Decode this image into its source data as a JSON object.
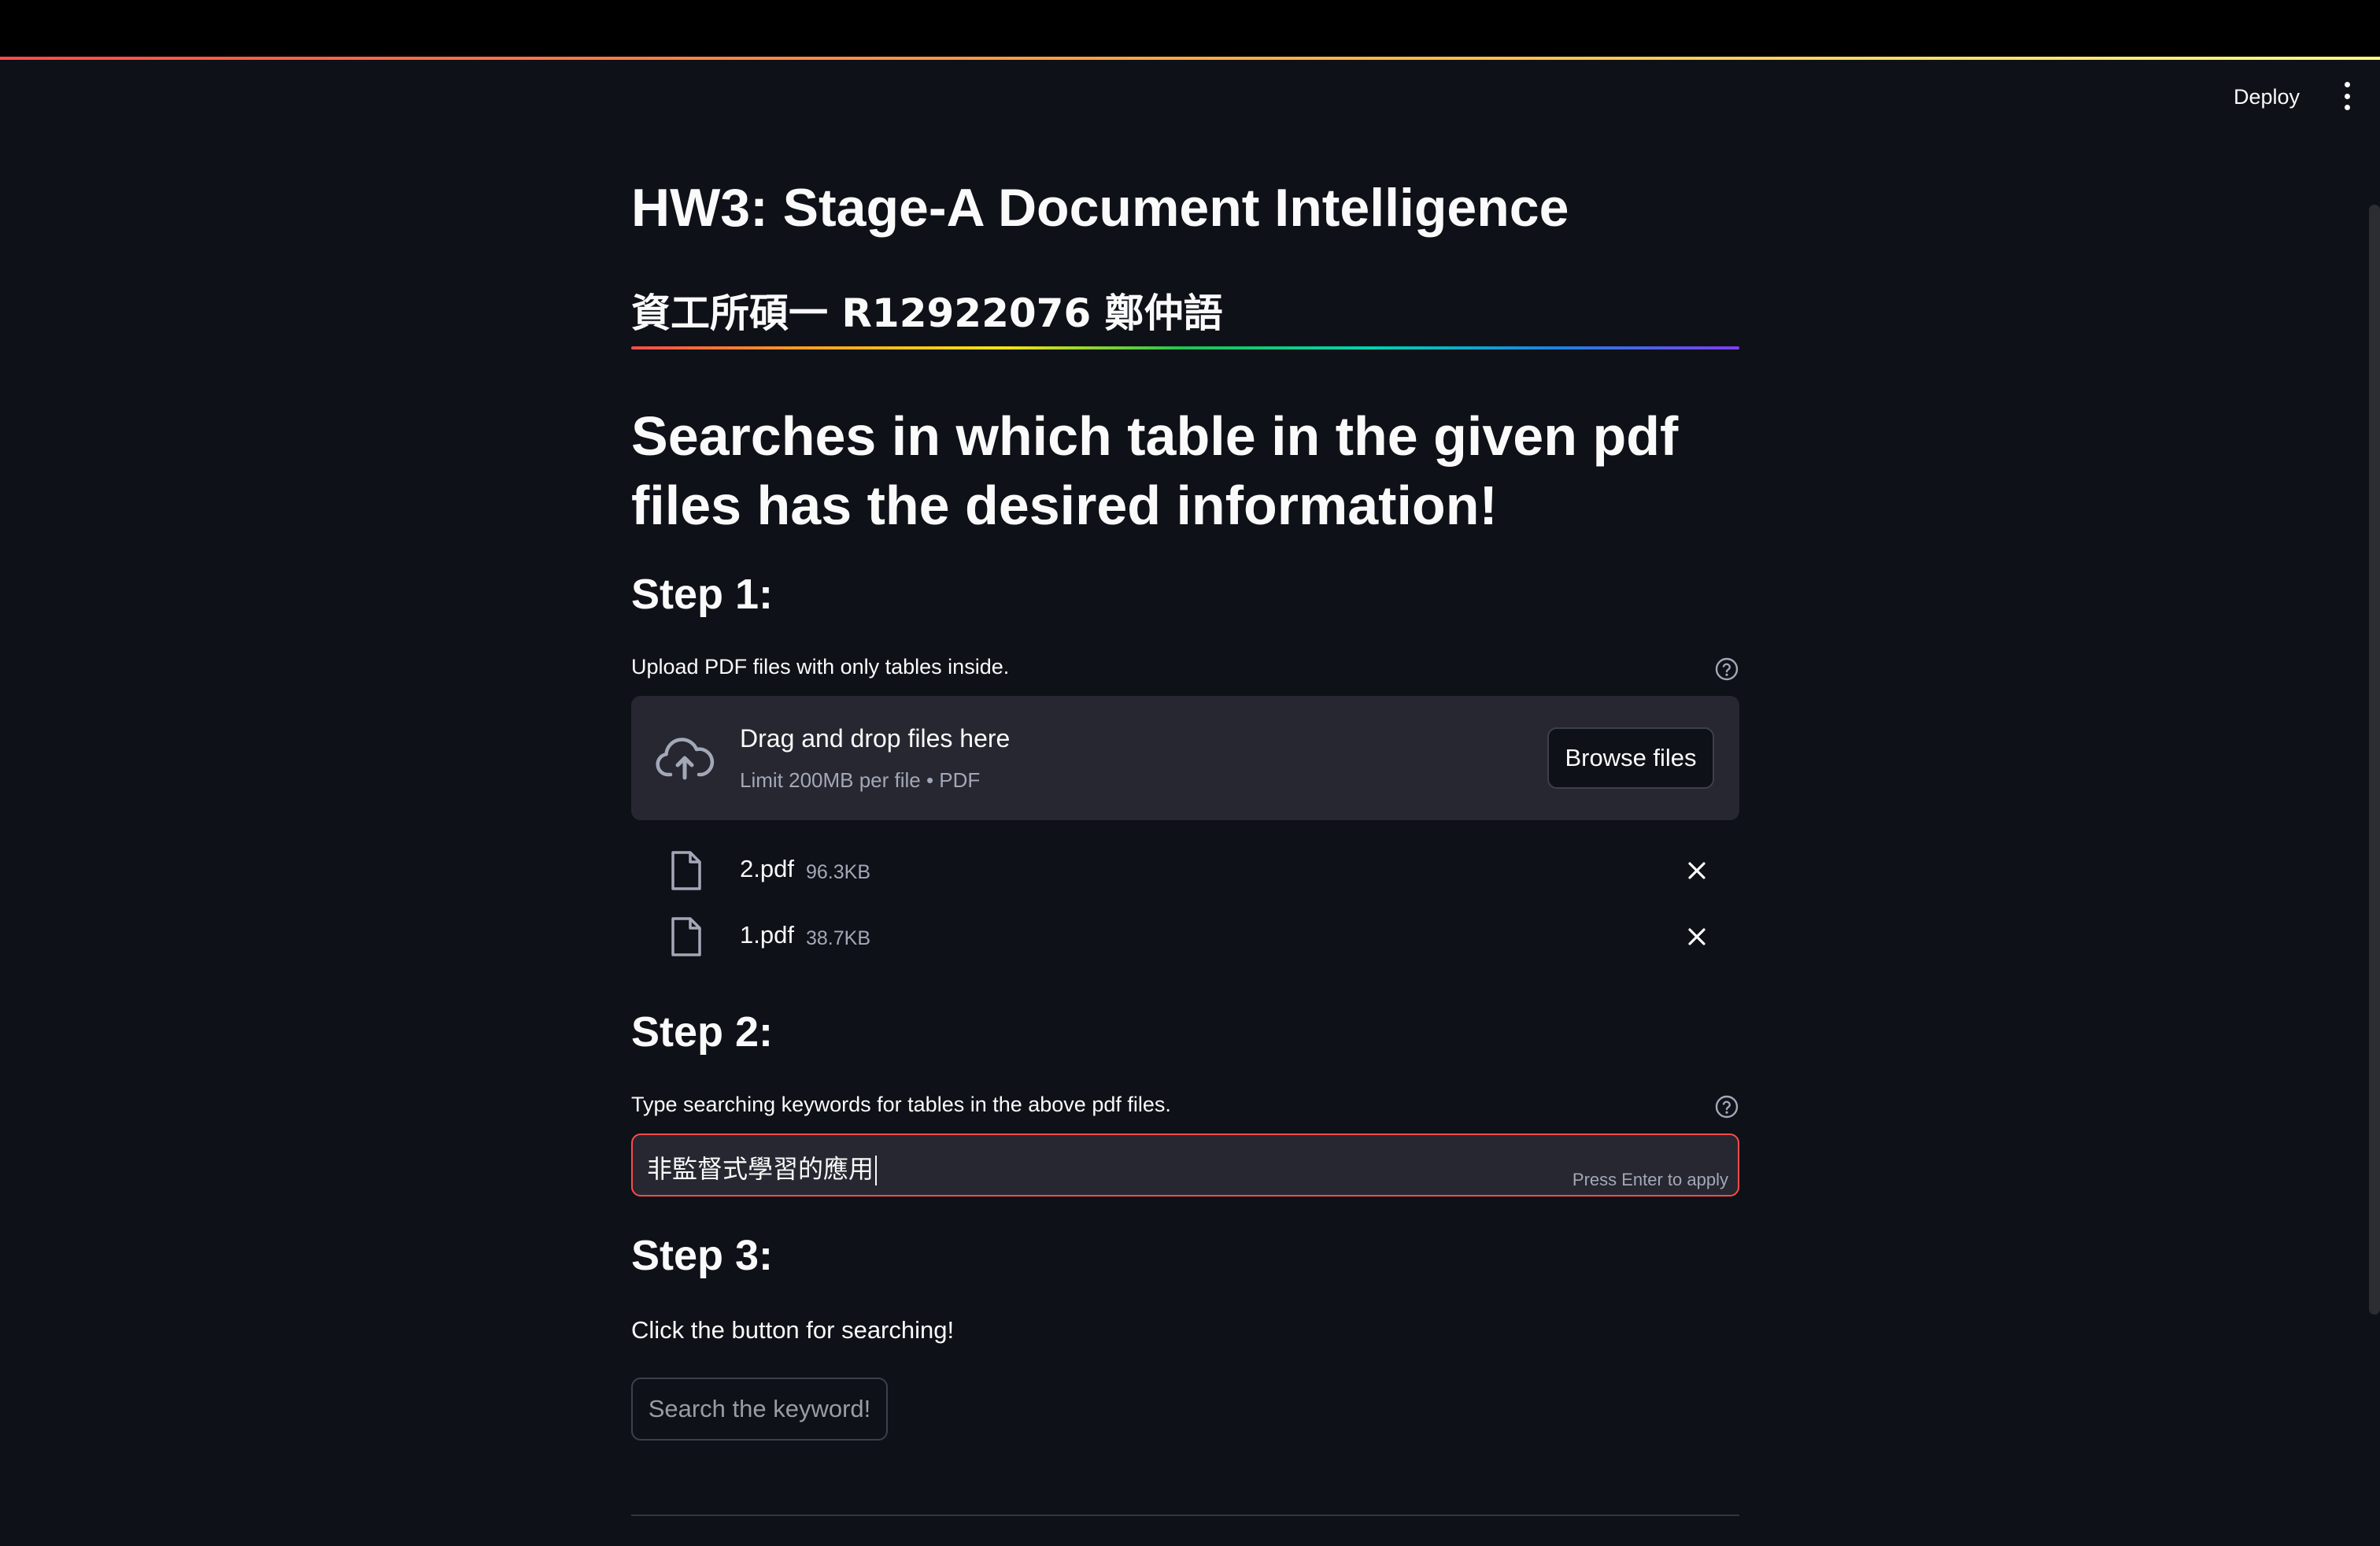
{
  "header": {
    "deploy_label": "Deploy",
    "menu_icon": "kebab-menu-icon"
  },
  "page": {
    "title": "HW3: Stage-A Document Intelligence",
    "subtitle": "資工所碩一 R12922076 鄭仲語",
    "headline": "Searches in which table in the given pdf files has the desired information!"
  },
  "step1": {
    "heading": "Step 1:",
    "label": "Upload PDF files with only tables inside.",
    "dropzone": {
      "title": "Drag and drop files here",
      "subtitle": "Limit 200MB per file • PDF",
      "browse_label": "Browse files",
      "icon": "cloud-upload-icon"
    },
    "files": [
      {
        "name": "2.pdf",
        "size": "96.3KB"
      },
      {
        "name": "1.pdf",
        "size": "38.7KB"
      }
    ]
  },
  "step2": {
    "heading": "Step 2:",
    "label": "Type searching keywords for tables in the above pdf files.",
    "input_value": "非監督式學習的應用",
    "input_hint": "Press Enter to apply"
  },
  "step3": {
    "heading": "Step 3:",
    "text": "Click the button for searching!",
    "button_label": "Search the keyword!"
  },
  "colors": {
    "background": "#0e1117",
    "surface": "#262730",
    "accent": "#ff4b4b",
    "muted_text": "#a3a8b8"
  }
}
